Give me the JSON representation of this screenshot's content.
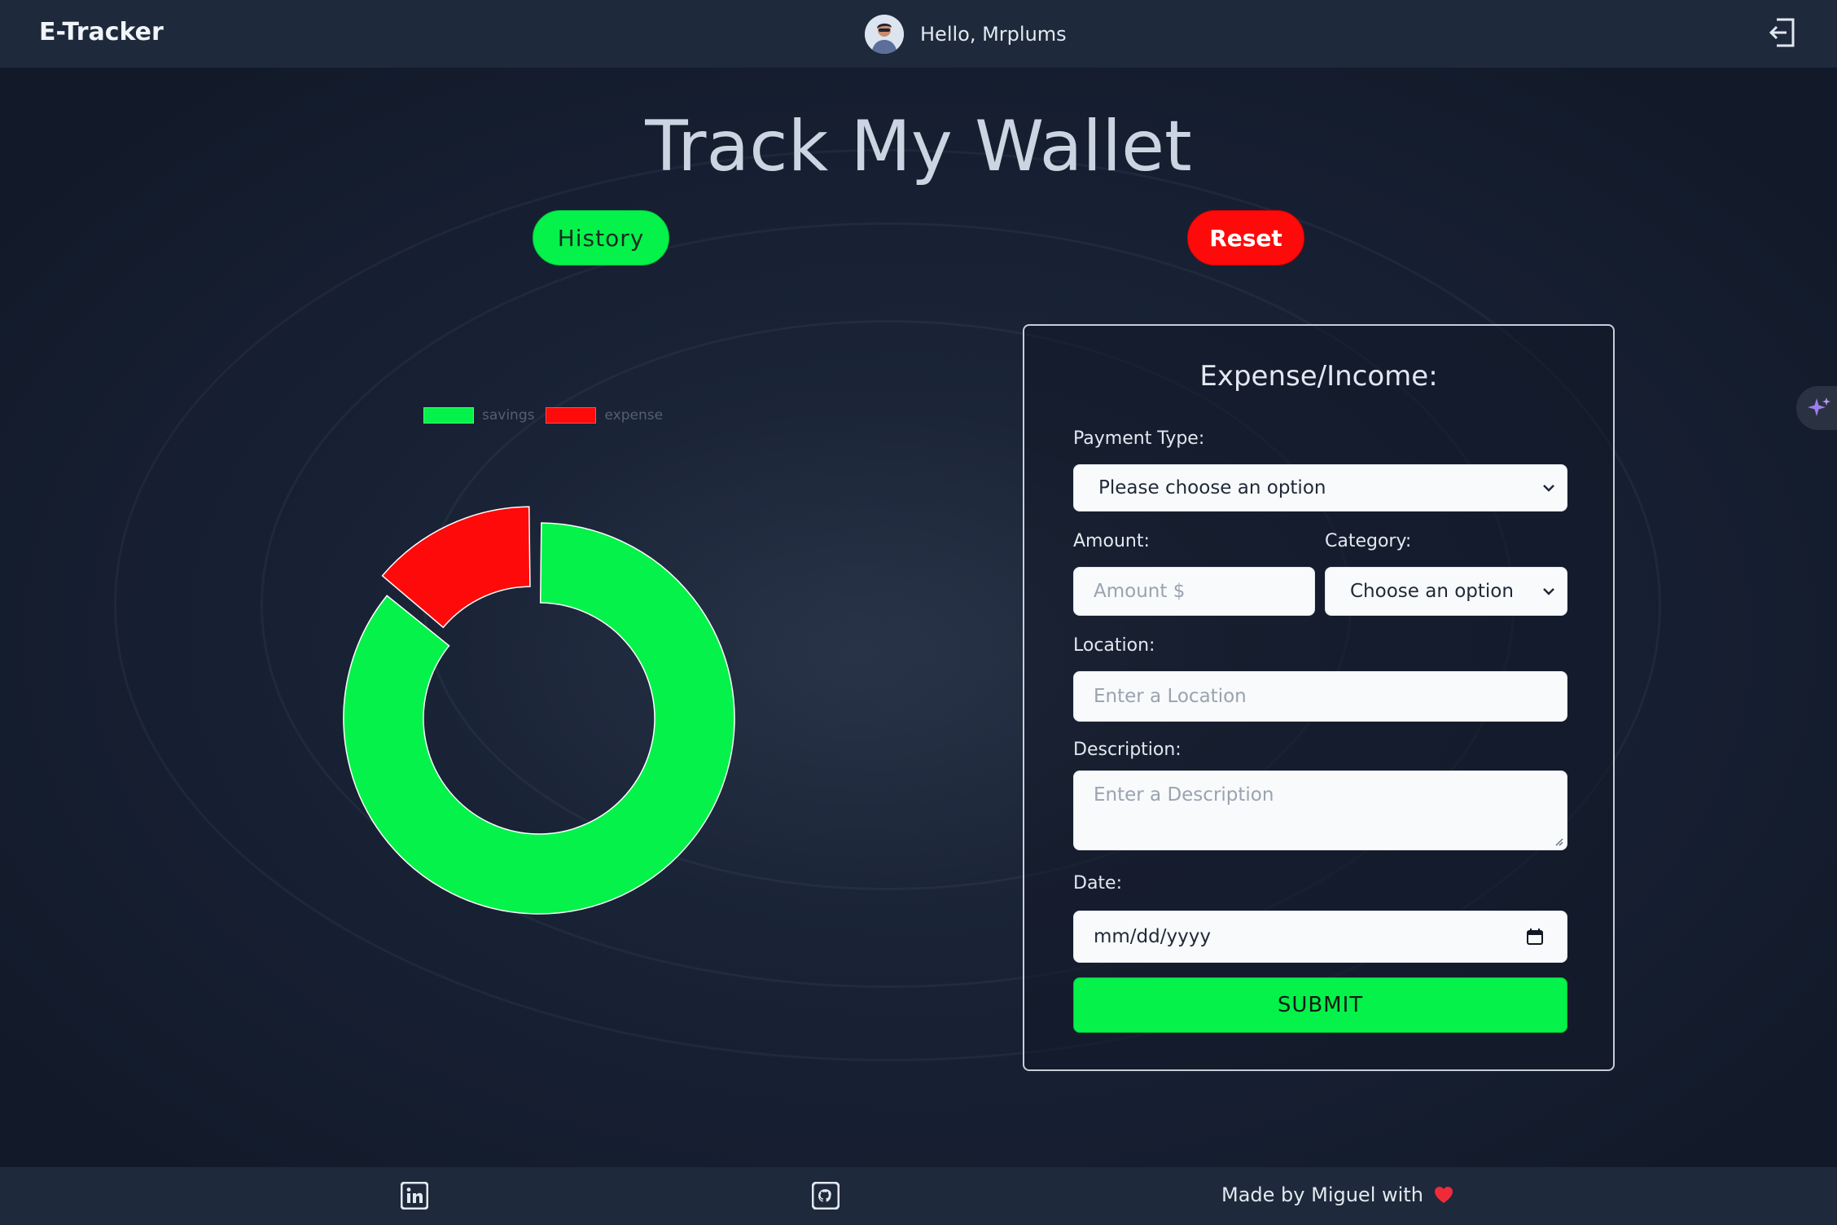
{
  "header": {
    "brand": "E-Tracker",
    "greeting": "Hello, Mrplums"
  },
  "main": {
    "title": "Track My Wallet",
    "history_label": "History",
    "reset_label": "Reset"
  },
  "chart_data": {
    "type": "pie",
    "donut": true,
    "categories": [
      "savings",
      "expense"
    ],
    "values": [
      86,
      14
    ],
    "colors": [
      "#05f24a",
      "#ff0a0a"
    ],
    "legend": "top"
  },
  "form": {
    "title": "Expense/Income:",
    "payment_type_label": "Payment Type:",
    "payment_type_value": "Please choose an option",
    "amount_label": "Amount:",
    "amount_placeholder": "Amount $",
    "category_label": "Category:",
    "category_value": "Choose an option",
    "location_label": "Location:",
    "location_placeholder": "Enter a Location",
    "description_label": "Description:",
    "description_placeholder": "Enter a Description",
    "date_label": "Date:",
    "date_placeholder": "mm/dd/yyyy",
    "submit_label": "SUBMIT"
  },
  "footer": {
    "credit": "Made by Miguel with",
    "icons": [
      "linkedin-icon",
      "github-icon",
      "heart-icon"
    ]
  },
  "colors": {
    "accent_green": "#05f24a",
    "accent_red": "#ff0a0a",
    "header_bg": "#1e293b"
  }
}
